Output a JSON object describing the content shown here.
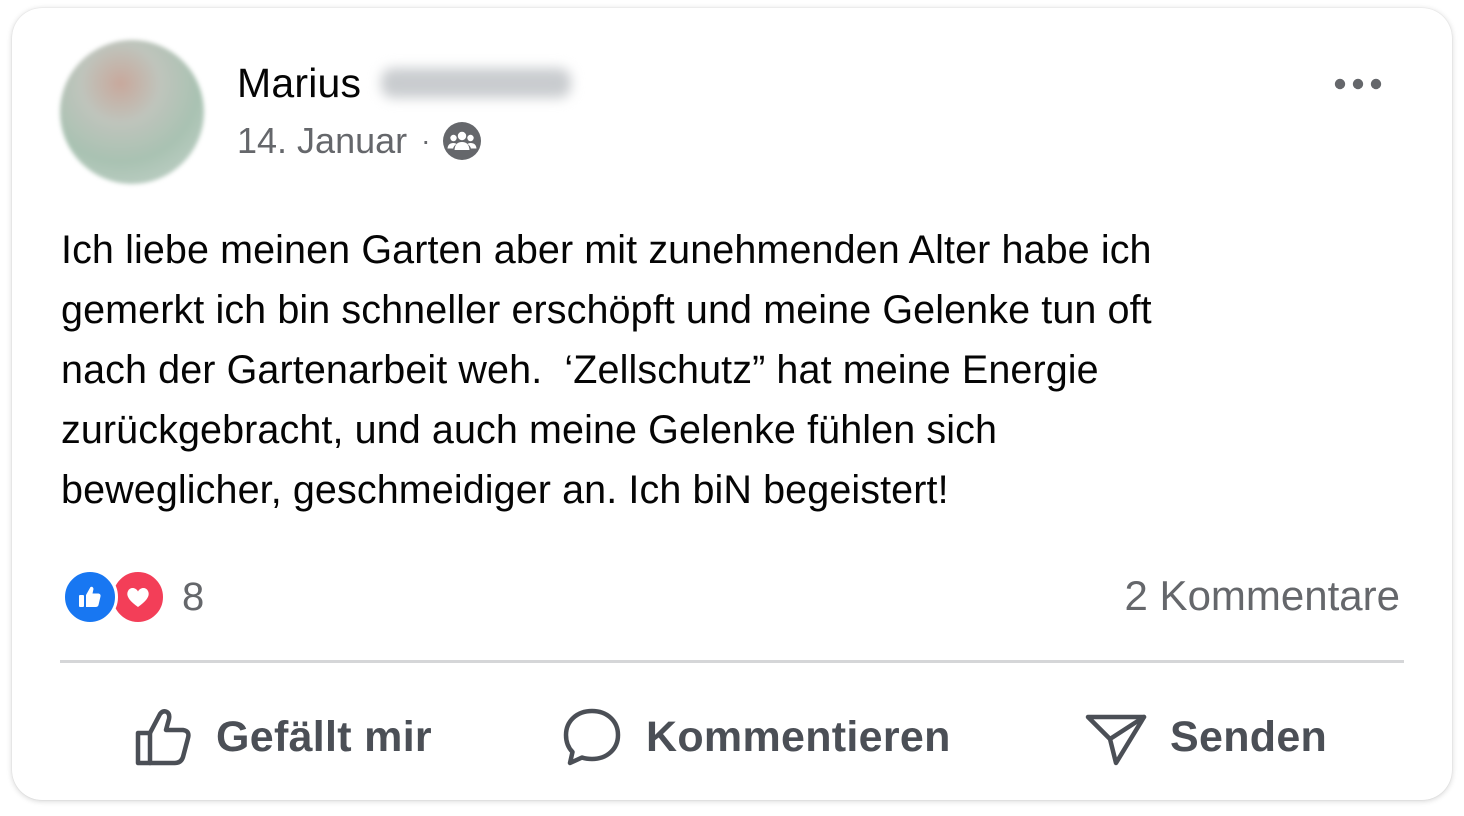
{
  "post": {
    "author_name": "Marius",
    "date": "14. Januar",
    "separator": "·",
    "audience_icon": "group-audience-icon",
    "text": "Ich liebe meinen Garten aber mit zunehmenden Alter habe ich\ngemerkt ich bin schneller erschöpft und meine Gelenke tun oft\nnach der Gartenarbeit weh.  ‘Zellschutz” hat meine Energie\nzurückgebracht, und auch meine Gelenke fühlen sich\nbeweglicher, geschmeidiger an. Ich biN begeistert!",
    "reaction_count": "8",
    "reaction_icons": [
      "like-reaction-icon",
      "love-reaction-icon"
    ],
    "comments_label": "2 Kommentare"
  },
  "actions": {
    "like_label": "Gefällt mir",
    "comment_label": "Kommentieren",
    "send_label": "Senden"
  },
  "colors": {
    "like_blue": "#1877f2",
    "love_red": "#f33e58",
    "secondary_text": "#65676b",
    "primary_text": "#050505"
  }
}
